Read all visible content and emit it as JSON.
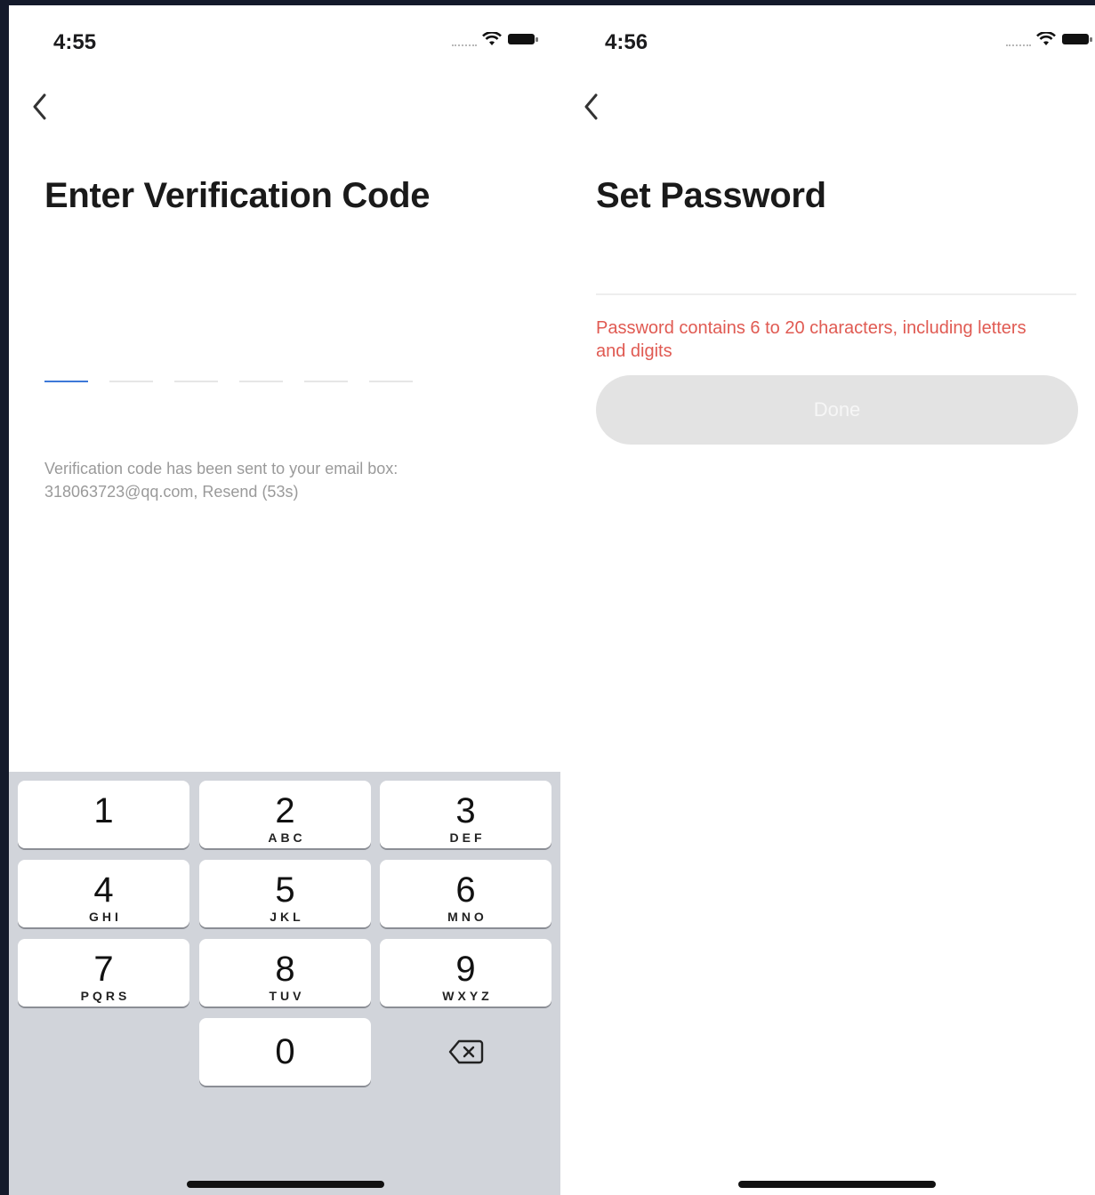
{
  "left_screen": {
    "status_time": "4:55",
    "title": "Enter Verification Code",
    "code_slots": 6,
    "hint": "Verification code has been sent to your email box: 318063723@qq.com, Resend (53s)",
    "keypad": [
      {
        "digit": "1",
        "letters": ""
      },
      {
        "digit": "2",
        "letters": "ABC"
      },
      {
        "digit": "3",
        "letters": "DEF"
      },
      {
        "digit": "4",
        "letters": "GHI"
      },
      {
        "digit": "5",
        "letters": "JKL"
      },
      {
        "digit": "6",
        "letters": "MNO"
      },
      {
        "digit": "7",
        "letters": "PQRS"
      },
      {
        "digit": "8",
        "letters": "TUV"
      },
      {
        "digit": "9",
        "letters": "WXYZ"
      },
      {
        "digit": "0",
        "letters": ""
      }
    ]
  },
  "right_screen": {
    "status_time": "4:56",
    "title": "Set Password",
    "error": "Password contains 6 to 20 characters, including letters and digits",
    "done_label": "Done"
  },
  "icons": {
    "back": "chevron-left-icon",
    "wifi": "wifi-icon",
    "battery": "battery-icon",
    "delete": "backspace-icon"
  },
  "colors": {
    "error": "#e05a52",
    "active_slot": "#3d78d8",
    "keypad_bg": "#d1d4da",
    "button_disabled": "#e3e3e3"
  }
}
